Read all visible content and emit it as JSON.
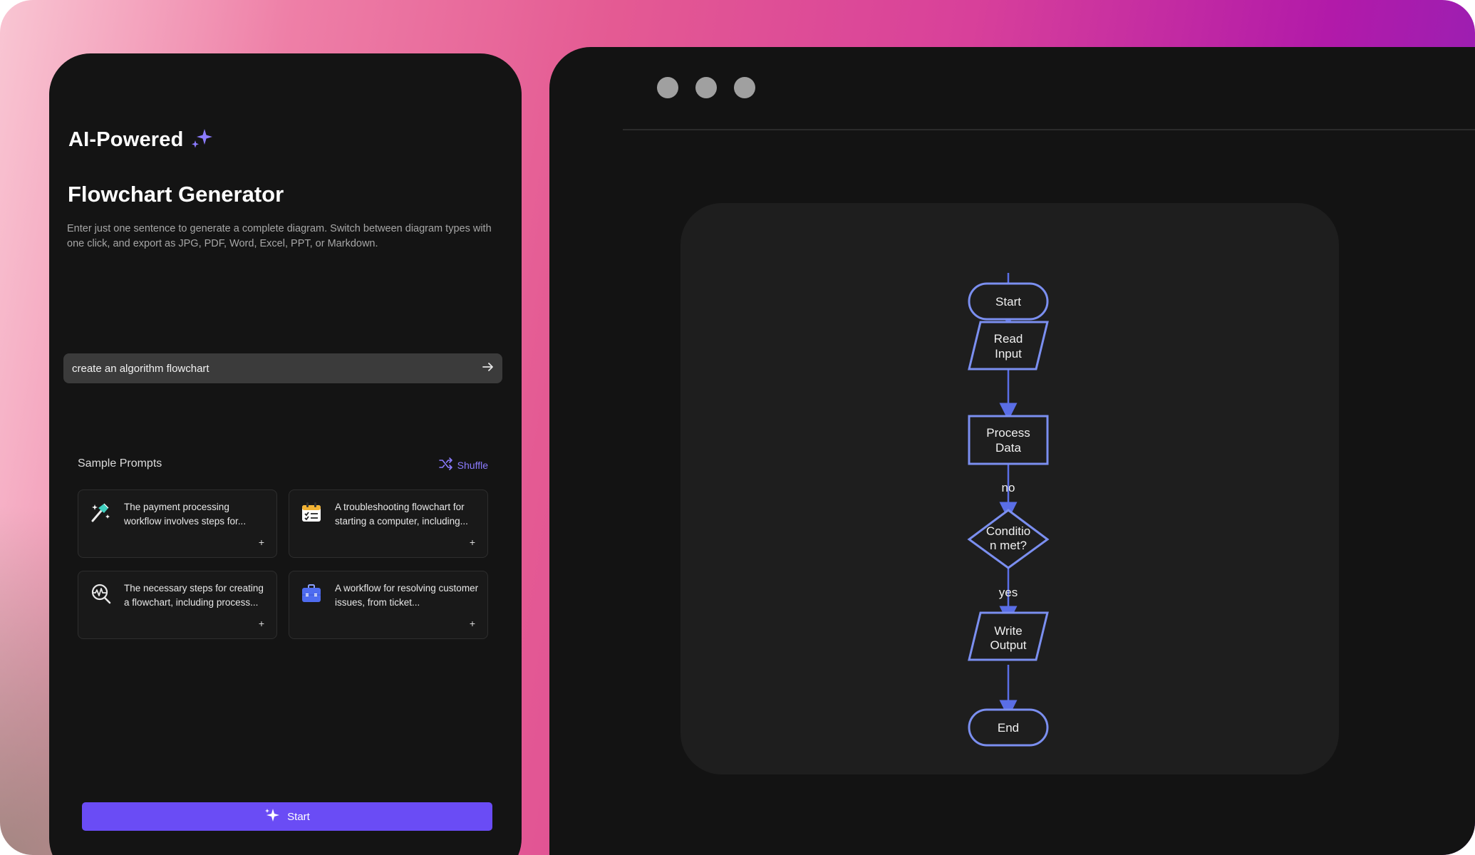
{
  "brand": {
    "title": "AI-Powered",
    "icon": "sparkle-icon"
  },
  "generator": {
    "title": "Flowchart Generator",
    "description": "Enter just one sentence to generate a complete diagram. Switch between diagram types with one click, and export as JPG, PDF, Word, Excel, PPT, or Markdown."
  },
  "prompt": {
    "value": "create an algorithm flowchart",
    "send_icon": "arrow-right-icon"
  },
  "samples": {
    "title": "Sample Prompts",
    "shuffle_label": "Shuffle",
    "items": [
      {
        "text": "The payment processing workflow involves steps for...",
        "icon": "magic-wand-icon"
      },
      {
        "text": "A troubleshooting flowchart for starting a computer, including...",
        "icon": "checklist-icon"
      },
      {
        "text": "The necessary steps for creating a flowchart, including process...",
        "icon": "search-pulse-icon"
      },
      {
        "text": "A workflow for resolving customer issues, from ticket...",
        "icon": "briefcase-icon"
      }
    ]
  },
  "start_button": {
    "label": "Start"
  },
  "flowchart": {
    "nodes": {
      "start": "Start",
      "read_1": "Read",
      "read_2": "Input",
      "process_1": "Process",
      "process_2": "Data",
      "cond_1": "Conditio",
      "cond_2": "n met?",
      "write_1": "Write",
      "write_2": "Output",
      "end": "End"
    },
    "edges": {
      "no": "no",
      "yes": "yes"
    },
    "colors": {
      "stroke": "#7b8ff0",
      "arrow": "#5a6ee6",
      "text": "#f0f0f0"
    }
  }
}
